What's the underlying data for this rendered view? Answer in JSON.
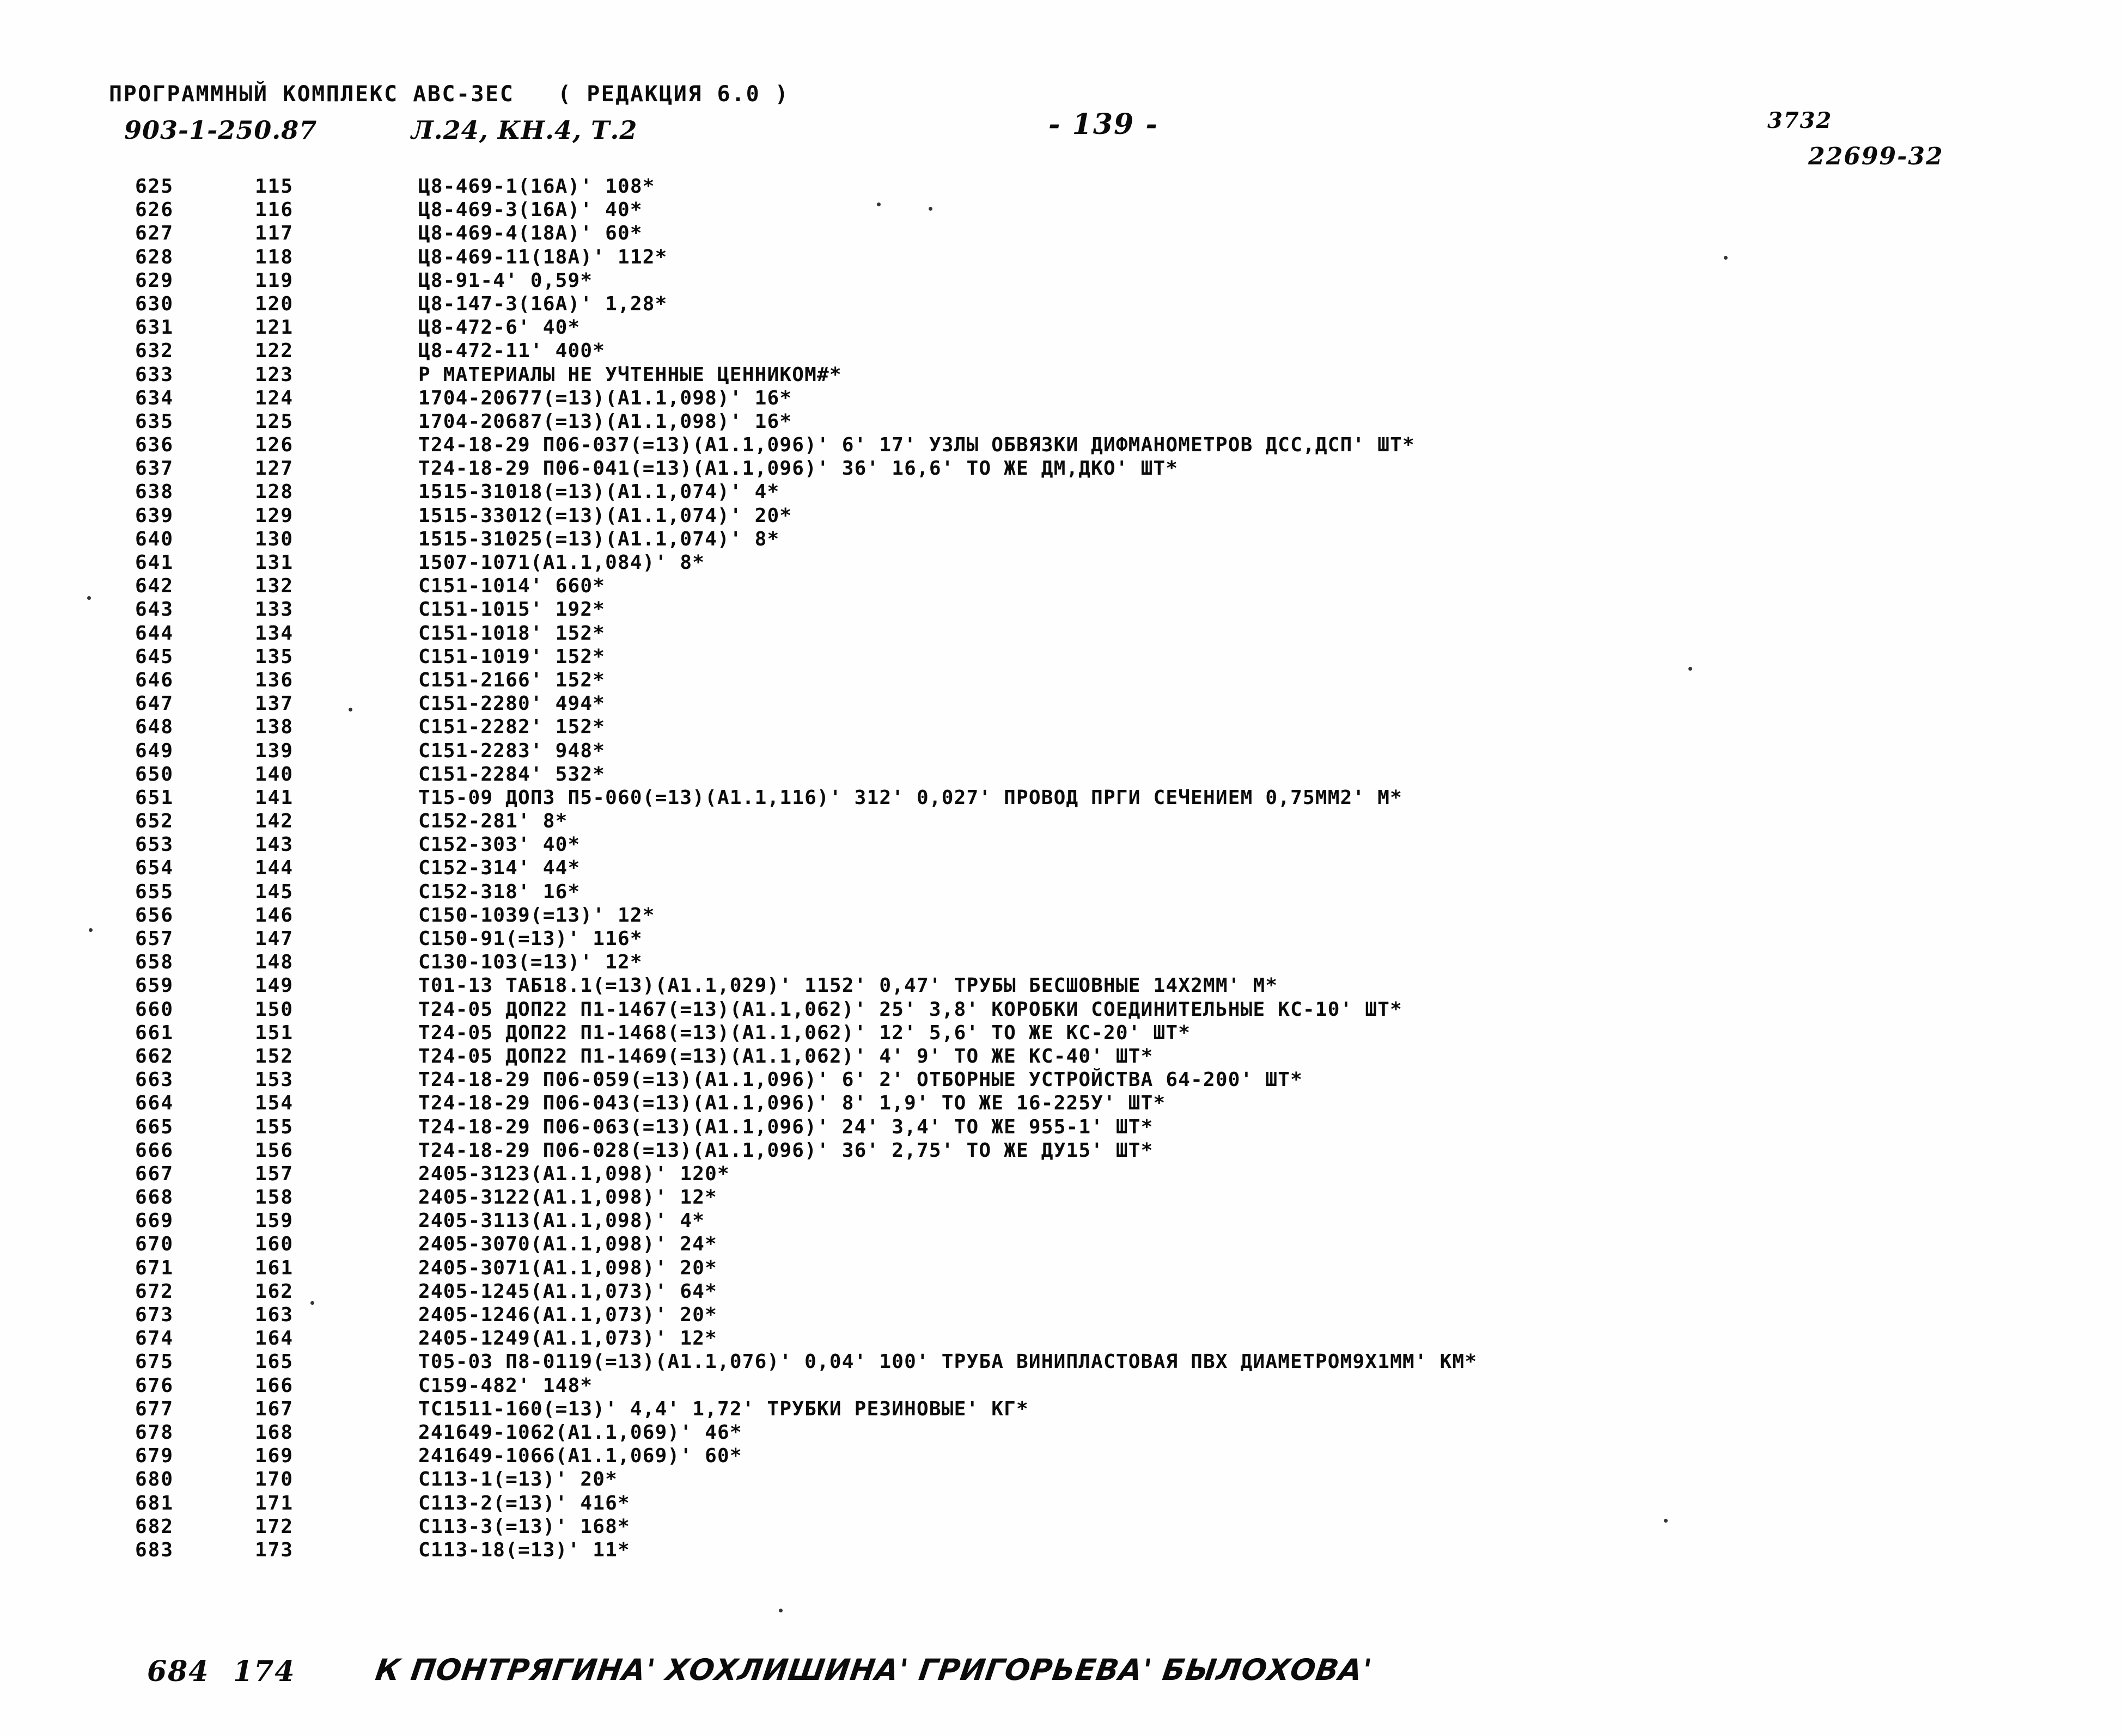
{
  "header": {
    "program_line": "ПРОГРАММНЫЙ КОМПЛЕКС ABC-3EC   ( РЕДАКЦИЯ 6.0 )",
    "doc_number": "903-1-250.87",
    "book_ref": "Л.24, КН.4, Т.2",
    "page_label": "- 139 -",
    "code_top": "3732",
    "code_bottom": "22699-32"
  },
  "listing": {
    "rows": [
      {
        "seq": "625",
        "idx": "115",
        "text": "Ц8-469-1(16А)' 108*"
      },
      {
        "seq": "626",
        "idx": "116",
        "text": "Ц8-469-3(16А)' 40*"
      },
      {
        "seq": "627",
        "idx": "117",
        "text": "Ц8-469-4(18А)' 60*"
      },
      {
        "seq": "628",
        "idx": "118",
        "text": "Ц8-469-11(18А)' 112*"
      },
      {
        "seq": "629",
        "idx": "119",
        "text": "Ц8-91-4' 0,59*"
      },
      {
        "seq": "630",
        "idx": "120",
        "text": "Ц8-147-3(16А)' 1,28*"
      },
      {
        "seq": "631",
        "idx": "121",
        "text": "Ц8-472-6' 40*"
      },
      {
        "seq": "632",
        "idx": "122",
        "text": "Ц8-472-11' 400*"
      },
      {
        "seq": "633",
        "idx": "123",
        "text": "Р МАТЕРИАЛЫ НЕ УЧТЕННЫЕ ЦЕННИКОМ#*"
      },
      {
        "seq": "634",
        "idx": "124",
        "text": "1704-20677(=13)(А1.1,098)' 16*"
      },
      {
        "seq": "635",
        "idx": "125",
        "text": "1704-20687(=13)(А1.1,098)' 16*"
      },
      {
        "seq": "636",
        "idx": "126",
        "text": "Т24-18-29 П06-037(=13)(А1.1,096)' 6' 17' УЗЛЫ ОБВЯЗКИ ДИФМАНОМЕТРОВ ДСС,ДСП' ШТ*"
      },
      {
        "seq": "637",
        "idx": "127",
        "text": "Т24-18-29 П06-041(=13)(А1.1,096)' 36' 16,6' ТО ЖЕ ДМ,ДКО' ШТ*"
      },
      {
        "seq": "638",
        "idx": "128",
        "text": "1515-31018(=13)(А1.1,074)' 4*"
      },
      {
        "seq": "639",
        "idx": "129",
        "text": "1515-33012(=13)(А1.1,074)' 20*"
      },
      {
        "seq": "640",
        "idx": "130",
        "text": "1515-31025(=13)(А1.1,074)' 8*"
      },
      {
        "seq": "641",
        "idx": "131",
        "text": "1507-1071(А1.1,084)' 8*"
      },
      {
        "seq": "642",
        "idx": "132",
        "text": "С151-1014' 660*"
      },
      {
        "seq": "643",
        "idx": "133",
        "text": "С151-1015' 192*"
      },
      {
        "seq": "644",
        "idx": "134",
        "text": "С151-1018' 152*"
      },
      {
        "seq": "645",
        "idx": "135",
        "text": "С151-1019' 152*"
      },
      {
        "seq": "646",
        "idx": "136",
        "text": "С151-2166' 152*"
      },
      {
        "seq": "647",
        "idx": "137",
        "text": "С151-2280' 494*"
      },
      {
        "seq": "648",
        "idx": "138",
        "text": "С151-2282' 152*"
      },
      {
        "seq": "649",
        "idx": "139",
        "text": "С151-2283' 948*"
      },
      {
        "seq": "650",
        "idx": "140",
        "text": "С151-2284' 532*"
      },
      {
        "seq": "651",
        "idx": "141",
        "text": "Т15-09 ДОП3 П5-060(=13)(А1.1,116)' 312' 0,027' ПРОВОД ПРГИ СЕЧЕНИЕМ 0,75ММ2' М*"
      },
      {
        "seq": "652",
        "idx": "142",
        "text": "С152-281' 8*"
      },
      {
        "seq": "653",
        "idx": "143",
        "text": "С152-303' 40*"
      },
      {
        "seq": "654",
        "idx": "144",
        "text": "С152-314' 44*"
      },
      {
        "seq": "655",
        "idx": "145",
        "text": "С152-318' 16*"
      },
      {
        "seq": "656",
        "idx": "146",
        "text": "С150-1039(=13)' 12*"
      },
      {
        "seq": "657",
        "idx": "147",
        "text": "С150-91(=13)' 116*"
      },
      {
        "seq": "658",
        "idx": "148",
        "text": "С130-103(=13)' 12*"
      },
      {
        "seq": "659",
        "idx": "149",
        "text": "Т01-13 ТАБ18.1(=13)(А1.1,029)' 1152' 0,47' ТРУБЫ БЕСШОВНЫЕ 14Х2ММ' М*"
      },
      {
        "seq": "660",
        "idx": "150",
        "text": "Т24-05 ДОП22 П1-1467(=13)(А1.1,062)' 25' 3,8' КОРОБКИ СОЕДИНИТЕЛЬНЫЕ КС-10' ШТ*"
      },
      {
        "seq": "661",
        "idx": "151",
        "text": "Т24-05 ДОП22 П1-1468(=13)(А1.1,062)' 12' 5,6' ТО ЖЕ КС-20' ШТ*"
      },
      {
        "seq": "662",
        "idx": "152",
        "text": "Т24-05 ДОП22 П1-1469(=13)(А1.1,062)' 4' 9' ТО ЖЕ КС-40' ШТ*"
      },
      {
        "seq": "663",
        "idx": "153",
        "text": "Т24-18-29 П06-059(=13)(А1.1,096)' 6' 2' ОТБОРНЫЕ УСТРОЙСТВА 64-200' ШТ*"
      },
      {
        "seq": "664",
        "idx": "154",
        "text": "Т24-18-29 П06-043(=13)(А1.1,096)' 8' 1,9' ТО ЖЕ 16-225У' ШТ*"
      },
      {
        "seq": "665",
        "idx": "155",
        "text": "Т24-18-29 П06-063(=13)(А1.1,096)' 24' 3,4' ТО ЖЕ 955-1' ШТ*"
      },
      {
        "seq": "666",
        "idx": "156",
        "text": "Т24-18-29 П06-028(=13)(А1.1,096)' 36' 2,75' ТО ЖЕ ДУ15' ШТ*"
      },
      {
        "seq": "667",
        "idx": "157",
        "text": "2405-3123(А1.1,098)' 120*"
      },
      {
        "seq": "668",
        "idx": "158",
        "text": "2405-3122(А1.1,098)' 12*"
      },
      {
        "seq": "669",
        "idx": "159",
        "text": "2405-3113(А1.1,098)' 4*"
      },
      {
        "seq": "670",
        "idx": "160",
        "text": "2405-3070(А1.1,098)' 24*"
      },
      {
        "seq": "671",
        "idx": "161",
        "text": "2405-3071(А1.1,098)' 20*"
      },
      {
        "seq": "672",
        "idx": "162",
        "text": "2405-1245(А1.1,073)' 64*"
      },
      {
        "seq": "673",
        "idx": "163",
        "text": "2405-1246(А1.1,073)' 20*"
      },
      {
        "seq": "674",
        "idx": "164",
        "text": "2405-1249(А1.1,073)' 12*"
      },
      {
        "seq": "675",
        "idx": "165",
        "text": "Т05-03 П8-0119(=13)(А1.1,076)' 0,04' 100' ТРУБА ВИНИПЛАСТОВАЯ ПВХ ДИАМЕТРОМ9Х1ММ' КМ*"
      },
      {
        "seq": "676",
        "idx": "166",
        "text": "С159-482' 148*"
      },
      {
        "seq": "677",
        "idx": "167",
        "text": "ТС1511-160(=13)' 4,4' 1,72' ТРУБКИ РЕЗИНОВЫЕ' КГ*"
      },
      {
        "seq": "678",
        "idx": "168",
        "text": "241649-1062(А1.1,069)' 46*"
      },
      {
        "seq": "679",
        "idx": "169",
        "text": "241649-1066(А1.1,069)' 60*"
      },
      {
        "seq": "680",
        "idx": "170",
        "text": "С113-1(=13)' 20*"
      },
      {
        "seq": "681",
        "idx": "171",
        "text": "С113-2(=13)' 416*"
      },
      {
        "seq": "682",
        "idx": "172",
        "text": "С113-3(=13)' 168*"
      },
      {
        "seq": "683",
        "idx": "173",
        "text": "С113-18(=13)' 11*"
      }
    ],
    "final_row": {
      "seq": "684",
      "idx": "174",
      "text": "К ПОНТРЯГИНА' ХОХЛИШИНА' ГРИГОРЬЕВА' БЫЛОХОВА'"
    }
  }
}
